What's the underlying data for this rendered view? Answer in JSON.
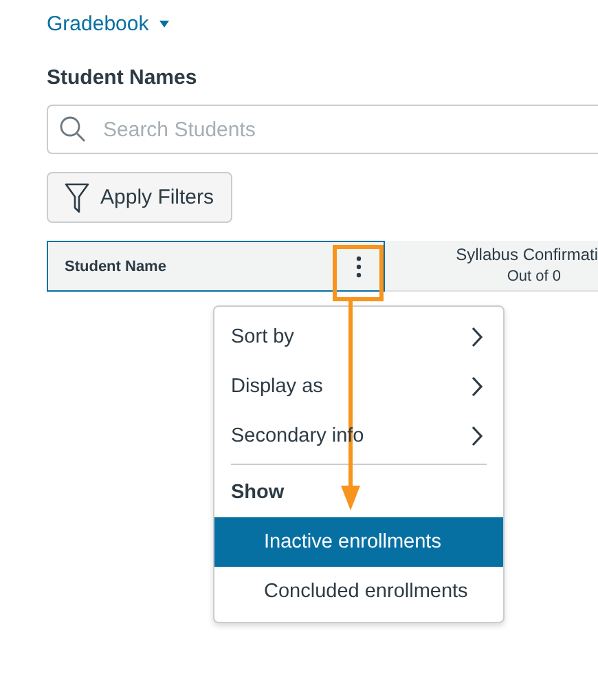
{
  "header": {
    "title": "Gradebook"
  },
  "section_title": "Student Names",
  "search": {
    "placeholder": "Search Students"
  },
  "filter_button": {
    "label": "Apply Filters"
  },
  "grid": {
    "columns": [
      {
        "title": "Student Name",
        "selected": true
      },
      {
        "title": "Syllabus Confirmati",
        "subtitle": "Out of 0",
        "selected": false
      }
    ]
  },
  "menu": {
    "items": [
      {
        "kind": "submenu",
        "label": "Sort by"
      },
      {
        "kind": "submenu",
        "label": "Display as"
      },
      {
        "kind": "submenu",
        "label": "Secondary info"
      },
      {
        "kind": "divider"
      },
      {
        "kind": "header",
        "label": "Show"
      },
      {
        "kind": "option",
        "label": "Inactive enrollments",
        "selected": true
      },
      {
        "kind": "option",
        "label": "Concluded enrollments",
        "selected": false
      }
    ]
  }
}
